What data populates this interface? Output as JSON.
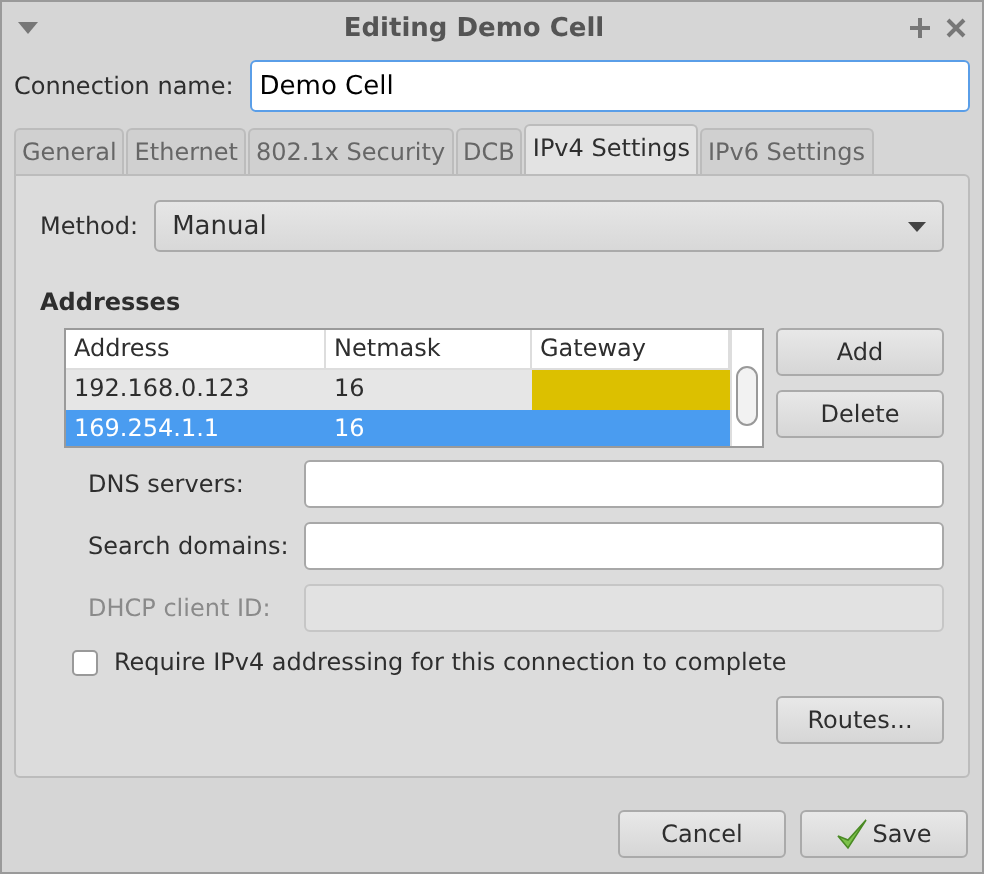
{
  "window": {
    "title": "Editing Demo Cell"
  },
  "connection_name": {
    "label": "Connection name:",
    "value": "Demo Cell"
  },
  "tabs": [
    {
      "label": "General",
      "selected": false
    },
    {
      "label": "Ethernet",
      "selected": false
    },
    {
      "label": "802.1x Security",
      "selected": false
    },
    {
      "label": "DCB",
      "selected": false
    },
    {
      "label": "IPv4 Settings",
      "selected": true
    },
    {
      "label": "IPv6 Settings",
      "selected": false
    }
  ],
  "method": {
    "label": "Method:",
    "value": "Manual"
  },
  "addresses": {
    "heading": "Addresses",
    "columns": [
      "Address",
      "Netmask",
      "Gateway"
    ],
    "rows": [
      {
        "address": "192.168.0.123",
        "netmask": "16",
        "gateway_invalid": true,
        "selected": false
      },
      {
        "address": "169.254.1.1",
        "netmask": "16",
        "gateway_invalid": false,
        "selected": true
      }
    ],
    "buttons": [
      "Add",
      "Delete"
    ]
  },
  "fields": [
    {
      "label": "DNS servers:",
      "disabled": false
    },
    {
      "label": "Search domains:",
      "disabled": false
    },
    {
      "label": "DHCP client ID:",
      "disabled": true
    }
  ],
  "require_checkbox": {
    "label": "Require IPv4 addressing for this connection to complete",
    "checked": false
  },
  "routes_button": "Routes...",
  "buttons": [
    {
      "label": "Cancel",
      "kind": "plain"
    },
    {
      "label": "Save",
      "kind": "confirm"
    }
  ]
}
